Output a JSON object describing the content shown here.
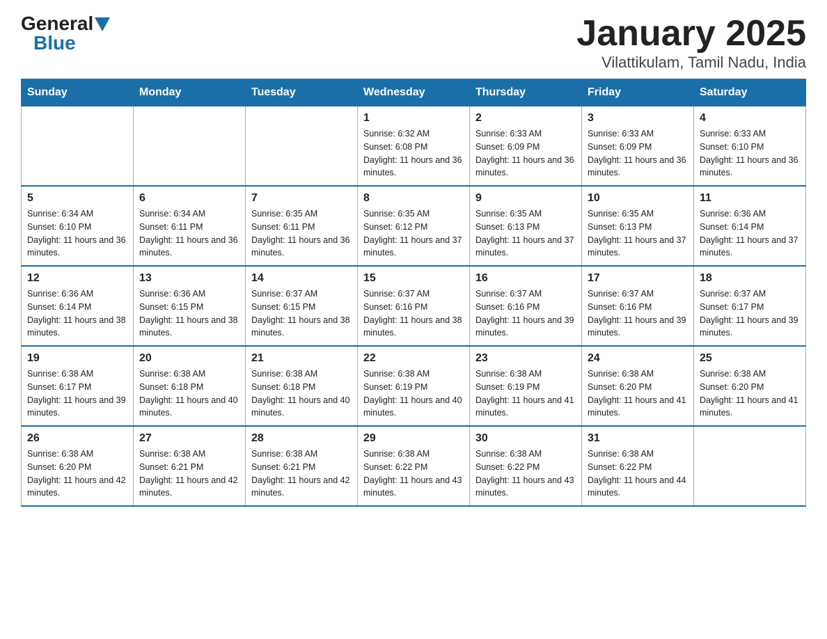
{
  "logo": {
    "general": "General",
    "blue": "Blue",
    "triangle": "▲"
  },
  "title": "January 2025",
  "subtitle": "Vilattikulam, Tamil Nadu, India",
  "headers": [
    "Sunday",
    "Monday",
    "Tuesday",
    "Wednesday",
    "Thursday",
    "Friday",
    "Saturday"
  ],
  "weeks": [
    [
      {
        "day": "",
        "info": ""
      },
      {
        "day": "",
        "info": ""
      },
      {
        "day": "",
        "info": ""
      },
      {
        "day": "1",
        "info": "Sunrise: 6:32 AM\nSunset: 6:08 PM\nDaylight: 11 hours and 36 minutes."
      },
      {
        "day": "2",
        "info": "Sunrise: 6:33 AM\nSunset: 6:09 PM\nDaylight: 11 hours and 36 minutes."
      },
      {
        "day": "3",
        "info": "Sunrise: 6:33 AM\nSunset: 6:09 PM\nDaylight: 11 hours and 36 minutes."
      },
      {
        "day": "4",
        "info": "Sunrise: 6:33 AM\nSunset: 6:10 PM\nDaylight: 11 hours and 36 minutes."
      }
    ],
    [
      {
        "day": "5",
        "info": "Sunrise: 6:34 AM\nSunset: 6:10 PM\nDaylight: 11 hours and 36 minutes."
      },
      {
        "day": "6",
        "info": "Sunrise: 6:34 AM\nSunset: 6:11 PM\nDaylight: 11 hours and 36 minutes."
      },
      {
        "day": "7",
        "info": "Sunrise: 6:35 AM\nSunset: 6:11 PM\nDaylight: 11 hours and 36 minutes."
      },
      {
        "day": "8",
        "info": "Sunrise: 6:35 AM\nSunset: 6:12 PM\nDaylight: 11 hours and 37 minutes."
      },
      {
        "day": "9",
        "info": "Sunrise: 6:35 AM\nSunset: 6:13 PM\nDaylight: 11 hours and 37 minutes."
      },
      {
        "day": "10",
        "info": "Sunrise: 6:35 AM\nSunset: 6:13 PM\nDaylight: 11 hours and 37 minutes."
      },
      {
        "day": "11",
        "info": "Sunrise: 6:36 AM\nSunset: 6:14 PM\nDaylight: 11 hours and 37 minutes."
      }
    ],
    [
      {
        "day": "12",
        "info": "Sunrise: 6:36 AM\nSunset: 6:14 PM\nDaylight: 11 hours and 38 minutes."
      },
      {
        "day": "13",
        "info": "Sunrise: 6:36 AM\nSunset: 6:15 PM\nDaylight: 11 hours and 38 minutes."
      },
      {
        "day": "14",
        "info": "Sunrise: 6:37 AM\nSunset: 6:15 PM\nDaylight: 11 hours and 38 minutes."
      },
      {
        "day": "15",
        "info": "Sunrise: 6:37 AM\nSunset: 6:16 PM\nDaylight: 11 hours and 38 minutes."
      },
      {
        "day": "16",
        "info": "Sunrise: 6:37 AM\nSunset: 6:16 PM\nDaylight: 11 hours and 39 minutes."
      },
      {
        "day": "17",
        "info": "Sunrise: 6:37 AM\nSunset: 6:16 PM\nDaylight: 11 hours and 39 minutes."
      },
      {
        "day": "18",
        "info": "Sunrise: 6:37 AM\nSunset: 6:17 PM\nDaylight: 11 hours and 39 minutes."
      }
    ],
    [
      {
        "day": "19",
        "info": "Sunrise: 6:38 AM\nSunset: 6:17 PM\nDaylight: 11 hours and 39 minutes."
      },
      {
        "day": "20",
        "info": "Sunrise: 6:38 AM\nSunset: 6:18 PM\nDaylight: 11 hours and 40 minutes."
      },
      {
        "day": "21",
        "info": "Sunrise: 6:38 AM\nSunset: 6:18 PM\nDaylight: 11 hours and 40 minutes."
      },
      {
        "day": "22",
        "info": "Sunrise: 6:38 AM\nSunset: 6:19 PM\nDaylight: 11 hours and 40 minutes."
      },
      {
        "day": "23",
        "info": "Sunrise: 6:38 AM\nSunset: 6:19 PM\nDaylight: 11 hours and 41 minutes."
      },
      {
        "day": "24",
        "info": "Sunrise: 6:38 AM\nSunset: 6:20 PM\nDaylight: 11 hours and 41 minutes."
      },
      {
        "day": "25",
        "info": "Sunrise: 6:38 AM\nSunset: 6:20 PM\nDaylight: 11 hours and 41 minutes."
      }
    ],
    [
      {
        "day": "26",
        "info": "Sunrise: 6:38 AM\nSunset: 6:20 PM\nDaylight: 11 hours and 42 minutes."
      },
      {
        "day": "27",
        "info": "Sunrise: 6:38 AM\nSunset: 6:21 PM\nDaylight: 11 hours and 42 minutes."
      },
      {
        "day": "28",
        "info": "Sunrise: 6:38 AM\nSunset: 6:21 PM\nDaylight: 11 hours and 42 minutes."
      },
      {
        "day": "29",
        "info": "Sunrise: 6:38 AM\nSunset: 6:22 PM\nDaylight: 11 hours and 43 minutes."
      },
      {
        "day": "30",
        "info": "Sunrise: 6:38 AM\nSunset: 6:22 PM\nDaylight: 11 hours and 43 minutes."
      },
      {
        "day": "31",
        "info": "Sunrise: 6:38 AM\nSunset: 6:22 PM\nDaylight: 11 hours and 44 minutes."
      },
      {
        "day": "",
        "info": ""
      }
    ]
  ],
  "colors": {
    "header_bg": "#1a6fa8",
    "header_text": "#ffffff",
    "border": "#aaaaaa",
    "week_border": "#1a6fa8"
  }
}
